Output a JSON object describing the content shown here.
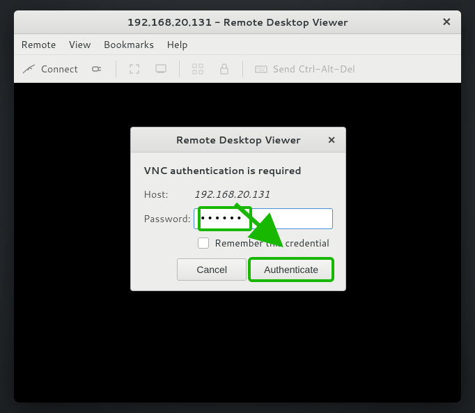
{
  "window": {
    "title": "192.168.20.131 - Remote Desktop Viewer"
  },
  "menubar": {
    "remote": "Remote",
    "view": "View",
    "bookmarks": "Bookmarks",
    "help": "Help"
  },
  "toolbar": {
    "connect": "Connect",
    "send_keys": "Send Ctrl-Alt-Del"
  },
  "dialog": {
    "title": "Remote Desktop Viewer",
    "heading": "VNC authentication is required",
    "host_label": "Host:",
    "host_value": "192.168.20.131",
    "password_label": "Password:",
    "password_value": "••••••",
    "remember_label": "Remember this credential",
    "cancel": "Cancel",
    "authenticate": "Authenticate"
  }
}
